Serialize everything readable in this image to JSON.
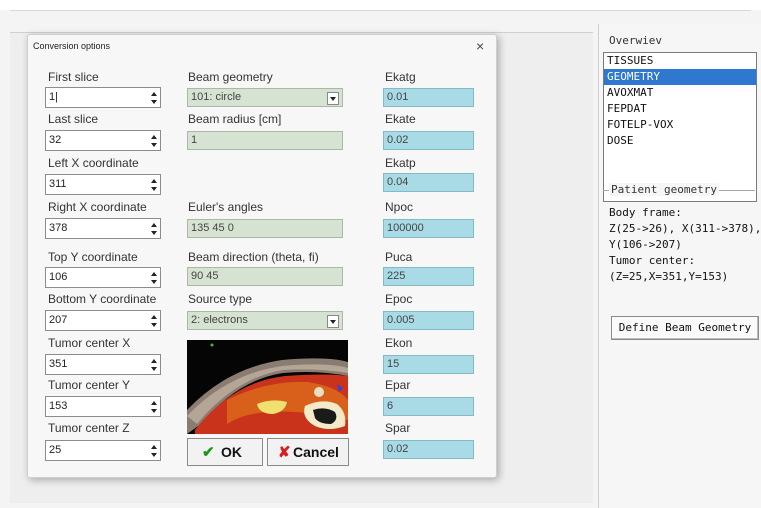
{
  "overview": {
    "title": "Overwiev",
    "items": [
      {
        "label": "TISSUES",
        "selected": false
      },
      {
        "label": "GEOMETRY",
        "selected": true
      },
      {
        "label": "AVOXMAT",
        "selected": false
      },
      {
        "label": "FEPDAT",
        "selected": false
      },
      {
        "label": "FOTELP-VOX",
        "selected": false
      },
      {
        "label": "DOSE",
        "selected": false
      }
    ]
  },
  "patient_geometry": {
    "title": "Patient geometry",
    "lines": [
      "Body frame:",
      "Z(25->26), X(311->378),",
      "Y(106->207)",
      "Tumor center:",
      "(Z=25,X=351,Y=153)"
    ]
  },
  "define_button": "Define Beam Geometry",
  "dialog": {
    "title": "Conversion options",
    "close_glyph": "×",
    "left_fields": [
      {
        "label": "First slice",
        "value": "1|"
      },
      {
        "label": "Last slice",
        "value": "32"
      },
      {
        "label": "Left X coordinate",
        "value": "311"
      },
      {
        "label": "Right X coordinate",
        "value": "378"
      },
      {
        "label": "Top Y coordinate",
        "value": "106"
      },
      {
        "label": "Bottom Y coordinate",
        "value": "207"
      },
      {
        "label": "Tumor center X",
        "value": "351"
      },
      {
        "label": "Tumor center Y",
        "value": "153"
      },
      {
        "label": "Tumor center Z",
        "value": "25"
      }
    ],
    "middle_fields": {
      "beam_geometry": {
        "label": "Beam geometry",
        "value": "101: circle"
      },
      "beam_radius": {
        "label": "Beam radius [cm]",
        "value": "1"
      },
      "euler_angles": {
        "label": "Euler's angles",
        "value": "135 45 0"
      },
      "beam_direction": {
        "label": "Beam direction (theta, fi)",
        "value": "90 45"
      },
      "source_type": {
        "label": "Source type",
        "value": "2: electrons"
      }
    },
    "right_fields": [
      {
        "label": "Ekatg",
        "value": "0.01"
      },
      {
        "label": "Ekate",
        "value": "0.02"
      },
      {
        "label": "Ekatp",
        "value": "0.04"
      },
      {
        "label": "Npoc",
        "value": "100000"
      },
      {
        "label": "Puca",
        "value": "225"
      },
      {
        "label": "Epoc",
        "value": "0.005"
      },
      {
        "label": "Ekon",
        "value": "15"
      },
      {
        "label": "Epar",
        "value": "6"
      },
      {
        "label": "Spar",
        "value": "0.02"
      }
    ],
    "ok_button": {
      "glyph": "✔",
      "label": "OK"
    },
    "cancel_button": {
      "glyph": "✘",
      "label": "Cancel"
    }
  },
  "colors": {
    "selection": "#2e78d0",
    "field_green": "#d7e3d2",
    "field_blue": "#a9dbe6",
    "ok_check": "#1a9a1a",
    "cancel_x": "#d42020"
  }
}
